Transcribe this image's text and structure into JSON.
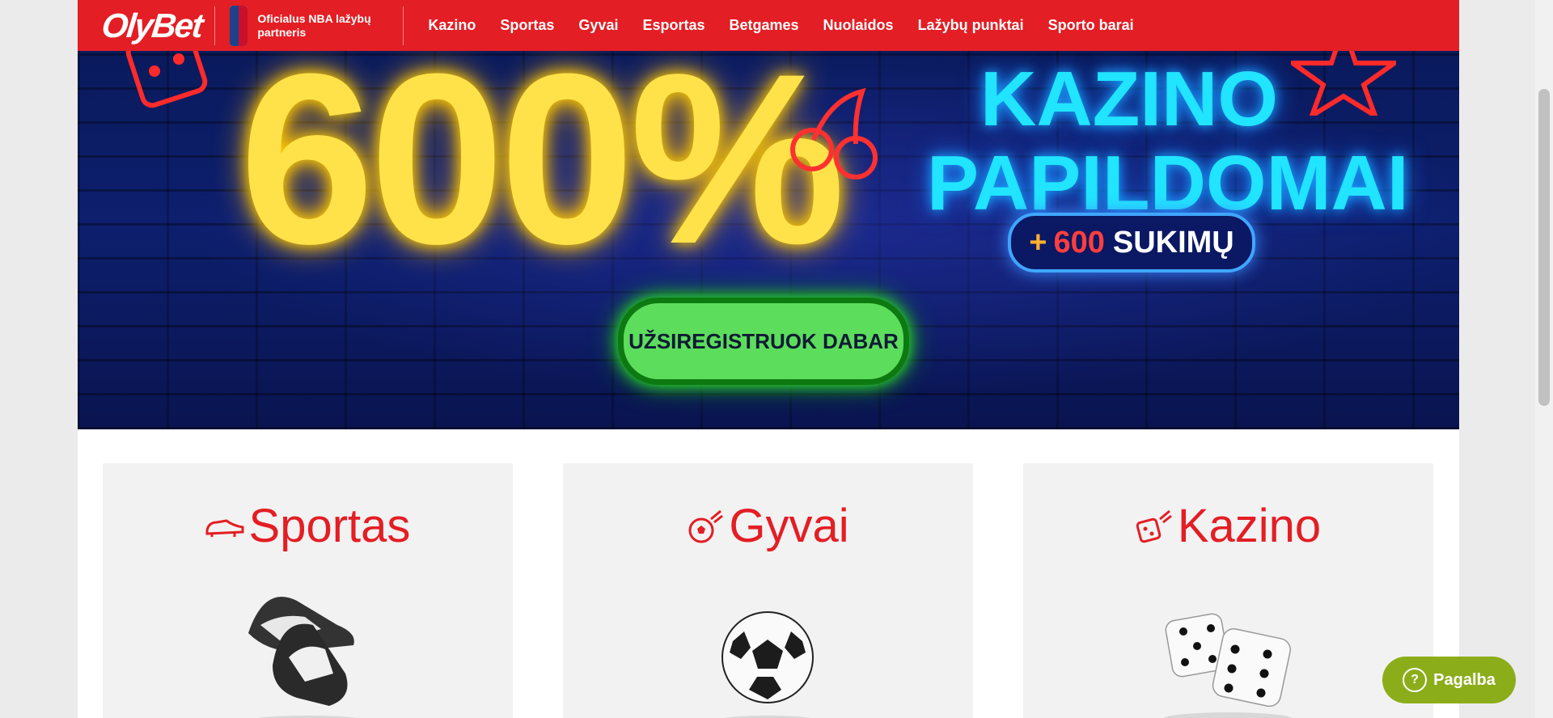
{
  "header": {
    "logo_text": "OlyBet",
    "partner_text": "Oficialus NBA lažybų partneris",
    "nav": [
      "Kazino",
      "Sportas",
      "Gyvai",
      "Esportas",
      "Betgames",
      "Nuolaidos",
      "Lažybų punktai",
      "Sporto barai"
    ]
  },
  "banner": {
    "headline": "600%",
    "line1": "KAZINO",
    "line2": "PAPILDOMAI",
    "spins_plus": "+",
    "spins_count": "600",
    "spins_label": "SUKIMŲ",
    "cta": "UŽSIREGISTRUOK DABAR"
  },
  "cards": [
    {
      "title": "Sportas",
      "icon": "cleat-icon"
    },
    {
      "title": "Gyvai",
      "icon": "soccer-ball-icon"
    },
    {
      "title": "Kazino",
      "icon": "dice-icon"
    }
  ],
  "help": {
    "label": "Pagalba"
  },
  "colors": {
    "brand_red": "#e31e24",
    "cta_green": "#5cdd5c",
    "help_green": "#8cad1a"
  }
}
